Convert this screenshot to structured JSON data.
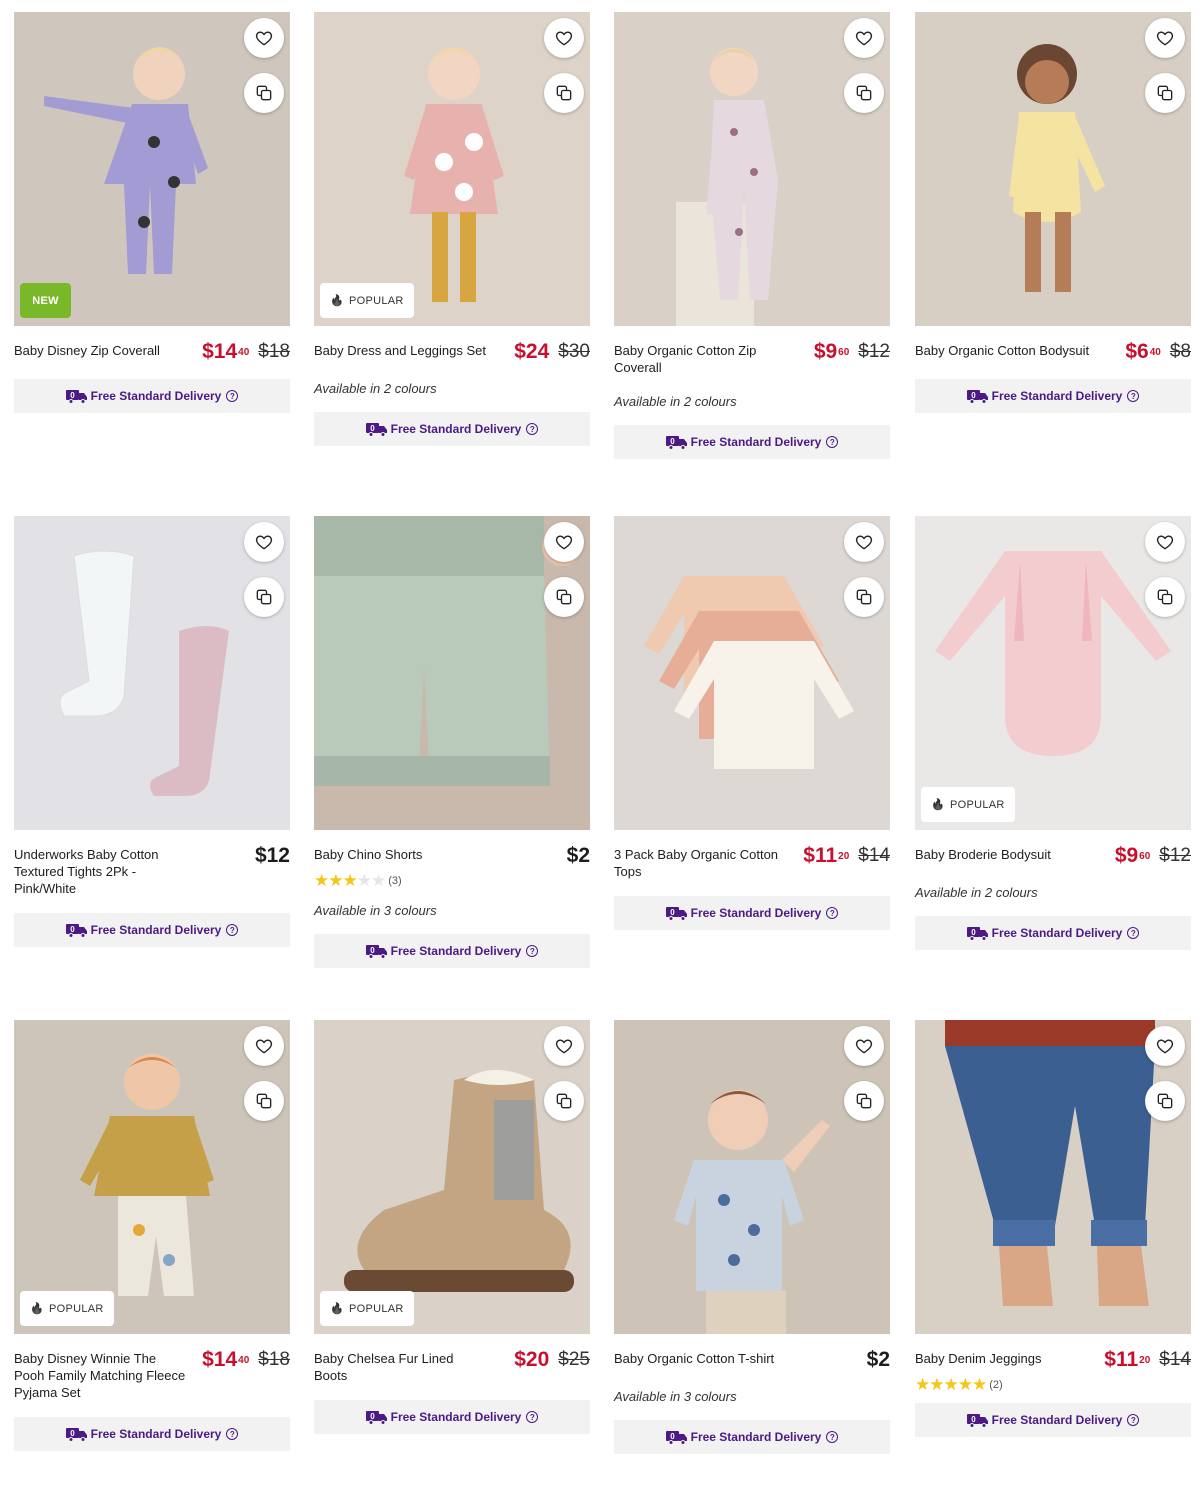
{
  "badges": {
    "new": "NEW",
    "popular": "POPULAR"
  },
  "delivery_label": "Free Standard Delivery",
  "colours": {
    "price_sale": "#c8102e",
    "delivery_text": "#4b1a85",
    "new_badge": "#79b829",
    "star": "#f5c518"
  },
  "products": [
    {
      "title": "Baby Disney Zip Coverall",
      "price": "$14",
      "price_cents": "40",
      "was": "$18",
      "was_cents": "",
      "on_sale": true,
      "badge": "NEW",
      "colours_text": "",
      "rating": null,
      "rating_count": "",
      "image": "lilac-coverall-toddler"
    },
    {
      "title": "Baby Dress and Leggings Set",
      "price": "$24",
      "price_cents": "",
      "was": "$30",
      "was_cents": "",
      "on_sale": true,
      "badge": "POPULAR",
      "colours_text": "Available in 2 colours",
      "rating": null,
      "rating_count": "",
      "image": "pink-daisy-dress-toddler"
    },
    {
      "title": "Baby Organic Cotton Zip Coverall",
      "price": "$9",
      "price_cents": "60",
      "was": "$12",
      "was_cents": "",
      "on_sale": true,
      "badge": "",
      "colours_text": "Available in 2 colours",
      "rating": null,
      "rating_count": "",
      "image": "floral-coverall-toddler"
    },
    {
      "title": "Baby Organic Cotton Bodysuit",
      "price": "$6",
      "price_cents": "40",
      "was": "$8",
      "was_cents": "",
      "on_sale": true,
      "badge": "",
      "colours_text": "",
      "rating": null,
      "rating_count": "",
      "image": "yellow-bodysuit-toddler"
    },
    {
      "title": "Underworks Baby Cotton Textured Tights 2Pk - Pink/White",
      "price": "$12",
      "price_cents": "",
      "was": "",
      "was_cents": "",
      "on_sale": false,
      "badge": "",
      "colours_text": "",
      "rating": null,
      "rating_count": "",
      "image": "tights-pair"
    },
    {
      "title": "Baby Chino Shorts",
      "price": "$2",
      "price_cents": "",
      "was": "",
      "was_cents": "",
      "on_sale": false,
      "badge": "",
      "colours_text": "Available in 3 colours",
      "rating": 3,
      "rating_count": "(3)",
      "image": "sage-chino-shorts"
    },
    {
      "title": "3 Pack Baby Organic Cotton Tops",
      "price": "$11",
      "price_cents": "20",
      "was": "$14",
      "was_cents": "",
      "on_sale": true,
      "badge": "",
      "colours_text": "",
      "rating": null,
      "rating_count": "",
      "image": "three-cotton-tops"
    },
    {
      "title": "Baby Broderie Bodysuit",
      "price": "$9",
      "price_cents": "60",
      "was": "$12",
      "was_cents": "",
      "on_sale": true,
      "badge": "POPULAR",
      "colours_text": "Available in 2 colours",
      "rating": null,
      "rating_count": "",
      "image": "pink-broderie-bodysuit"
    },
    {
      "title": "Baby Disney Winnie The Pooh Family Matching Fleece Pyjama Set",
      "price": "$14",
      "price_cents": "40",
      "was": "$18",
      "was_cents": "",
      "on_sale": true,
      "badge": "POPULAR",
      "colours_text": "",
      "rating": null,
      "rating_count": "",
      "image": "pooh-pyjama-baby"
    },
    {
      "title": "Baby Chelsea Fur Lined Boots",
      "price": "$20",
      "price_cents": "",
      "was": "$25",
      "was_cents": "",
      "on_sale": true,
      "badge": "POPULAR",
      "colours_text": "",
      "rating": null,
      "rating_count": "",
      "image": "suede-chelsea-boot"
    },
    {
      "title": "Baby Organic Cotton T-shirt",
      "price": "$2",
      "price_cents": "",
      "was": "",
      "was_cents": "",
      "on_sale": false,
      "badge": "",
      "colours_text": "Available in 3 colours",
      "rating": null,
      "rating_count": "",
      "image": "floral-tshirt-toddler"
    },
    {
      "title": "Baby Denim Jeggings",
      "price": "$11",
      "price_cents": "20",
      "was": "$14",
      "was_cents": "",
      "on_sale": true,
      "badge": "",
      "colours_text": "",
      "rating": 5,
      "rating_count": "(2)",
      "image": "denim-jeggings-legs"
    }
  ]
}
